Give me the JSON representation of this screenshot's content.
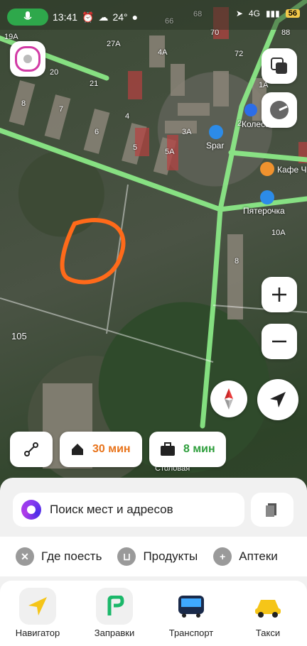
{
  "status": {
    "time": "13:41",
    "temp": "24°",
    "battery": "56",
    "signal": "4G"
  },
  "map": {
    "house_numbers": [
      "19А",
      "27А",
      "20",
      "21",
      "8",
      "7",
      "6",
      "4",
      "5",
      "5А",
      "3А",
      "4А",
      "66",
      "68",
      "70",
      "72",
      "88",
      "1А",
      "2",
      "10А",
      "8",
      "105"
    ],
    "poi": {
      "kolesa": "Колеса",
      "spar": "Spar",
      "kafe": "Кафе Ч",
      "pyaterochka": "Пятерочка",
      "stolovaya": "Столовая"
    }
  },
  "chips": {
    "home_time": "30 мин",
    "work_time": "8 мин"
  },
  "search": {
    "placeholder": "Поиск мест и адресов"
  },
  "categories": [
    {
      "label": "Где поесть",
      "icon": "fork-knife-icon"
    },
    {
      "label": "Продукты",
      "icon": "basket-icon"
    },
    {
      "label": "Аптеки",
      "icon": "plus-icon"
    }
  ],
  "services": [
    {
      "label": "Навигатор",
      "icon": "navigator-arrow-icon"
    },
    {
      "label": "Заправки",
      "icon": "fuel-icon"
    },
    {
      "label": "Транспорт",
      "icon": "bus-icon"
    },
    {
      "label": "Такси",
      "icon": "taxi-icon"
    }
  ],
  "colors": {
    "home_time": "#e8731a",
    "work_time": "#2e9e3c",
    "route": "#8ef08a",
    "annotation": "#ff6a1a"
  }
}
